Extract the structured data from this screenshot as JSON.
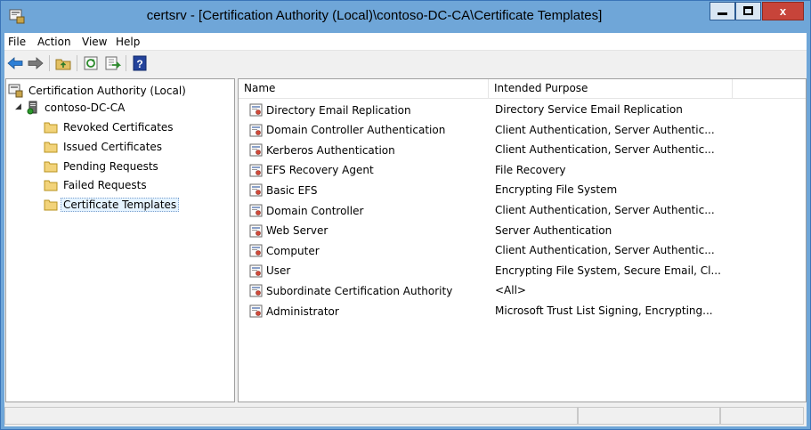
{
  "window": {
    "title": "certsrv - [Certification Authority (Local)\\contoso-DC-CA\\Certificate Templates]",
    "controls": {
      "minimize": "minimize",
      "maximize": "maximize",
      "close_label": "x"
    }
  },
  "menu": [
    "File",
    "Action",
    "View",
    "Help"
  ],
  "toolbar": {
    "buttons": [
      "back-arrow-icon",
      "forward-arrow-icon",
      "up-folder-icon",
      "refresh-icon",
      "export-list-icon",
      "help-icon"
    ]
  },
  "tree": {
    "root": "Certification Authority (Local)",
    "ca": "contoso-DC-CA",
    "children": [
      "Revoked Certificates",
      "Issued Certificates",
      "Pending Requests",
      "Failed Requests",
      "Certificate Templates"
    ],
    "selected": "Certificate Templates"
  },
  "list": {
    "columns": [
      "Name",
      "Intended Purpose"
    ],
    "rows": [
      {
        "name": "Directory Email Replication",
        "purpose": "Directory Service Email Replication"
      },
      {
        "name": "Domain Controller Authentication",
        "purpose": "Client Authentication, Server Authentic..."
      },
      {
        "name": "Kerberos Authentication",
        "purpose": "Client Authentication, Server Authentic..."
      },
      {
        "name": "EFS Recovery Agent",
        "purpose": "File Recovery"
      },
      {
        "name": "Basic EFS",
        "purpose": "Encrypting File System"
      },
      {
        "name": "Domain Controller",
        "purpose": "Client Authentication, Server Authentic..."
      },
      {
        "name": "Web Server",
        "purpose": "Server Authentication"
      },
      {
        "name": "Computer",
        "purpose": "Client Authentication, Server Authentic..."
      },
      {
        "name": "User",
        "purpose": "Encrypting File System, Secure Email, Cl..."
      },
      {
        "name": "Subordinate Certification Authority",
        "purpose": "<All>"
      },
      {
        "name": "Administrator",
        "purpose": "Microsoft Trust List Signing, Encrypting..."
      }
    ]
  },
  "statusbar": {
    "panels": [
      "",
      "",
      ""
    ]
  },
  "colors": {
    "titlebar": "#6fa6d8",
    "close": "#c7443a",
    "selection": "#e5f3ff"
  }
}
